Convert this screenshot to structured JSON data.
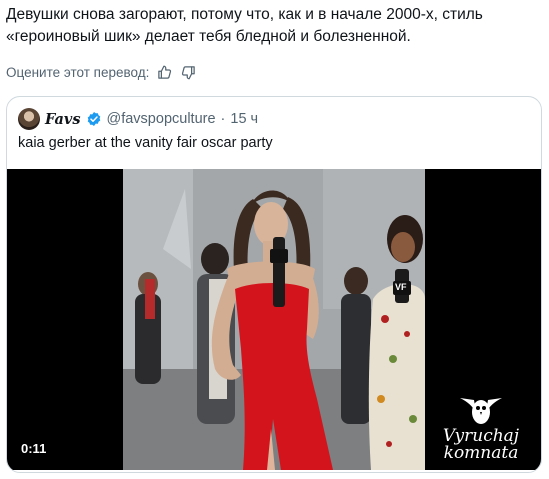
{
  "post": {
    "translated_text": "Девушки снова загорают, потому что, как и в начале 2000-х, стиль «героиновый шик» делает тебя бледной и болезненной.",
    "rate_translation_label": "Оцените этот перевод:",
    "icons": [
      "thumbs-up-icon",
      "thumbs-down-icon"
    ]
  },
  "quote": {
    "author_name": "Favs",
    "handle": "@favspopculture",
    "separator": "·",
    "time": "15 ч",
    "text": "kaia gerber at the vanity fair oscar party",
    "verified_color": "#1d9bf0",
    "media": {
      "duration": "0:11",
      "mic_flag_text": "VF",
      "watermark_line1": "Vyruchaj",
      "watermark_line2": "komnata"
    }
  },
  "colors": {
    "text": "#0f1419",
    "secondary": "#536471",
    "border": "#cfd9de",
    "dress": "#d4141c"
  }
}
